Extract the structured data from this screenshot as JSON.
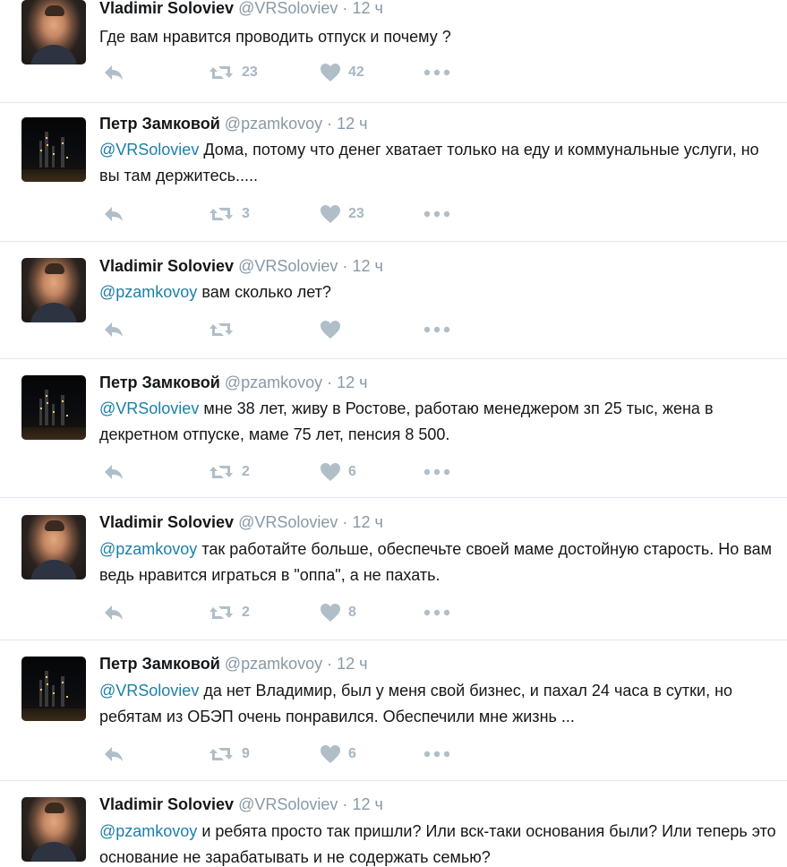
{
  "tweets": [
    {
      "author": "vs",
      "name": "Vladimir Soloviev",
      "handle": "@VRSoloviev",
      "time": "12 ч",
      "mention": "",
      "text": "Где вам нравится проводить отпуск и почему ?",
      "retweets": "23",
      "likes": "42"
    },
    {
      "author": "pz",
      "name": "Петр Замковой",
      "handle": "@pzamkovoy",
      "time": "12 ч",
      "mention": "@VRSoloviev",
      "text": "Дома, потому что денег хватает только на еду и коммунальные услуги, но вы там держитесь.....",
      "retweets": "3",
      "likes": "23"
    },
    {
      "author": "vs",
      "name": "Vladimir Soloviev",
      "handle": "@VRSoloviev",
      "time": "12 ч",
      "mention": "@pzamkovoy",
      "text": "вам сколько лет?",
      "retweets": "",
      "likes": ""
    },
    {
      "author": "pz",
      "name": "Петр Замковой",
      "handle": "@pzamkovoy",
      "time": "12 ч",
      "mention": "@VRSoloviev",
      "text": "мне 38 лет, живу в Ростове, работаю менеджером зп 25 тыс, жена в декретном отпуске, маме 75 лет, пенсия 8 500.",
      "retweets": "2",
      "likes": "6"
    },
    {
      "author": "vs",
      "name": "Vladimir Soloviev",
      "handle": "@VRSoloviev",
      "time": "12 ч",
      "mention": "@pzamkovoy",
      "text": "так работайте больше, обеспечьте своей маме достойную старость. Но вам ведь нравится играться в \"оппа\", а не пахать.",
      "retweets": "2",
      "likes": "8"
    },
    {
      "author": "pz",
      "name": "Петр Замковой",
      "handle": "@pzamkovoy",
      "time": "12 ч",
      "mention": "@VRSoloviev",
      "text": "да нет Владимир,  был у меня свой бизнес, и пахал 24 часа в сутки, но ребятам из ОБЭП очень понравился. Обеспечили мне жизнь ...",
      "retweets": "9",
      "likes": "6"
    },
    {
      "author": "vs",
      "name": "Vladimir Soloviev",
      "handle": "@VRSoloviev",
      "time": "12 ч",
      "mention": "@pzamkovoy",
      "text": "и ребята просто так пришли? Или вск-таки основания были? Или теперь это основание не зарабатывать и не содержать семью?",
      "retweets": "",
      "likes": ""
    }
  ]
}
